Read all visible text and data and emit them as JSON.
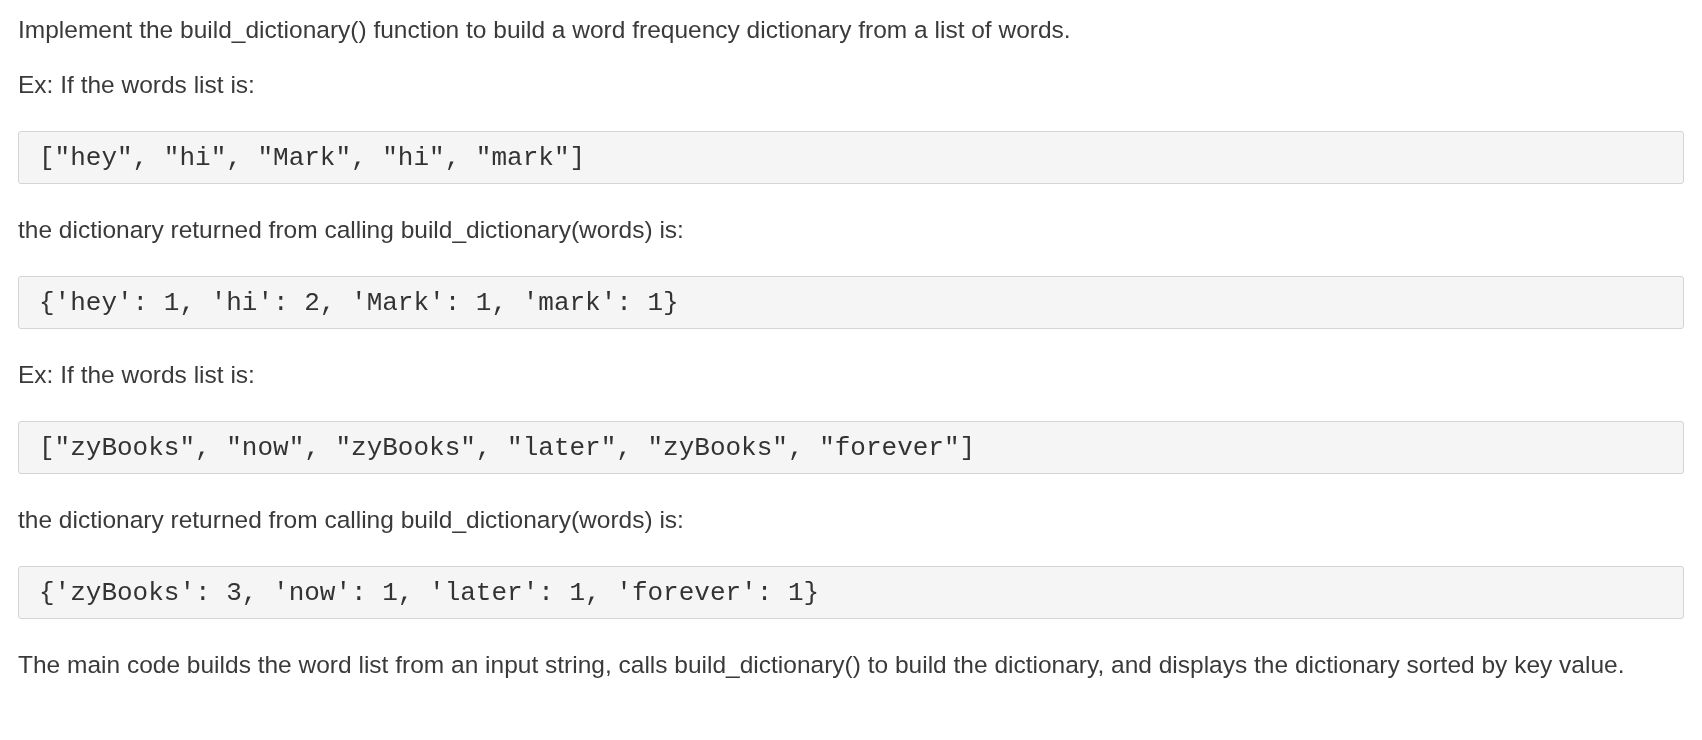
{
  "blocks": [
    {
      "kind": "paragraph",
      "text": "Implement the build_dictionary() function to build a word frequency dictionary from a list of words."
    },
    {
      "kind": "paragraph",
      "text": "Ex: If the words list is:"
    },
    {
      "kind": "code",
      "text": "[\"hey\", \"hi\", \"Mark\", \"hi\", \"mark\"]"
    },
    {
      "kind": "paragraph",
      "text": "the dictionary returned from calling build_dictionary(words) is:"
    },
    {
      "kind": "code",
      "text": "{'hey': 1, 'hi': 2, 'Mark': 1, 'mark': 1}"
    },
    {
      "kind": "paragraph",
      "text": "Ex: If the words list is:"
    },
    {
      "kind": "code",
      "text": "[\"zyBooks\", \"now\", \"zyBooks\", \"later\", \"zyBooks\", \"forever\"]"
    },
    {
      "kind": "paragraph",
      "text": "the dictionary returned from calling build_dictionary(words) is:"
    },
    {
      "kind": "code",
      "text": "{'zyBooks': 3, 'now': 1, 'later': 1, 'forever': 1}"
    },
    {
      "kind": "paragraph",
      "text": "The main code builds the word list from an input string, calls build_dictionary() to build the dictionary, and displays the dictionary sorted by key value."
    }
  ]
}
